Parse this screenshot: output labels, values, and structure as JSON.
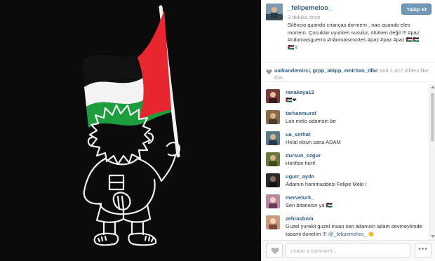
{
  "post": {
    "username": "_felipemeloo_",
    "time": "3 dakika önce",
    "caption": "Silêncio quando crianças dormem , nao quando eles morrem. Çocuklar uyurken susulur, ölürken değil !!! #paz #nãomaisguerra #nãomaismortes #paz #paz #paz 🇵🇸🇵🇸🇵🇸✌"
  },
  "follow_button": {
    "label": "Takip Et"
  },
  "likes": {
    "names": "ualkandemirci, grpp_aktpp, emirhan_dlkc",
    "rest": " and 1,317 others like this."
  },
  "comments": [
    {
      "user": "ranakaya12",
      "text": "🇵🇸❤",
      "avatar_color": "#7a3a3a"
    },
    {
      "user": "tarhanmurat",
      "text": "Lan melo adamsin be",
      "avatar_color": "#8a6a45"
    },
    {
      "user": "ua_serhat",
      "text": "Helal olsun sana ADAM",
      "avatar_color": "#5a7a8a"
    },
    {
      "user": "dursun_ozgur",
      "text": "Herifsin herif.",
      "avatar_color": "#6a7a3a"
    },
    {
      "user": "ugurr_aydn",
      "text": "Adamın hammaddesi Felipe Melo !",
      "avatar_color": "#2a2a2a"
    },
    {
      "user": "merveturk_",
      "text": "Sen bitanesin ya 🇵🇸",
      "avatar_color": "#b88aa0"
    },
    {
      "user": "zehrasbnm",
      "text": "Guzel yurekli guzel insan sen adamsin adam sevmeylimde tasami donelim !!! ",
      "mention": "@_felipemeloo_",
      "text_end": " 👏",
      "avatar_color": "#c89a7a"
    }
  ],
  "input": {
    "placeholder": "Leave a comment..."
  },
  "more_button": {
    "label": "•••"
  },
  "colors": {
    "link": "#2e5e86",
    "follow_bg": "#6f97b6",
    "photo_bg": "#0b0b0b",
    "flag_red": "#e8262f",
    "flag_white": "#ffffff",
    "flag_green": "#1e9d3e",
    "flag_black": "#111111"
  }
}
